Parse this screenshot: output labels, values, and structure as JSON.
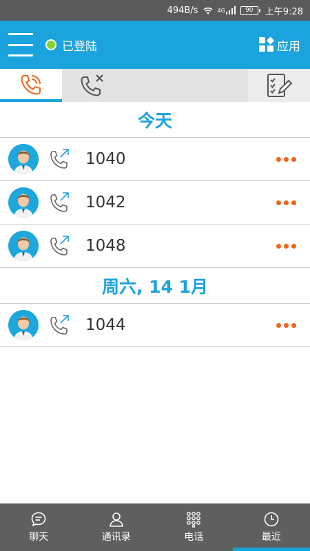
{
  "status_bar": {
    "speed": "494B/s",
    "signal": "4G",
    "battery": "90",
    "time": "上午9:28"
  },
  "header": {
    "status": "已登陆",
    "apps_label": "应用"
  },
  "colors": {
    "brand": "#1aa3dc",
    "accent_orange": "#f26419",
    "online_green": "#8bd12b"
  },
  "sections": [
    {
      "title": "今天",
      "calls": [
        {
          "number": "1040"
        },
        {
          "number": "1042"
        },
        {
          "number": "1048"
        }
      ]
    },
    {
      "title": "周六, 14 1月",
      "calls": [
        {
          "number": "1044"
        }
      ]
    }
  ],
  "bottom_nav": [
    {
      "label": "聊天",
      "icon": "chat-icon"
    },
    {
      "label": "通讯录",
      "icon": "contacts-icon"
    },
    {
      "label": "电话",
      "icon": "dialpad-icon"
    },
    {
      "label": "最近",
      "icon": "clock-icon",
      "active": true
    }
  ]
}
